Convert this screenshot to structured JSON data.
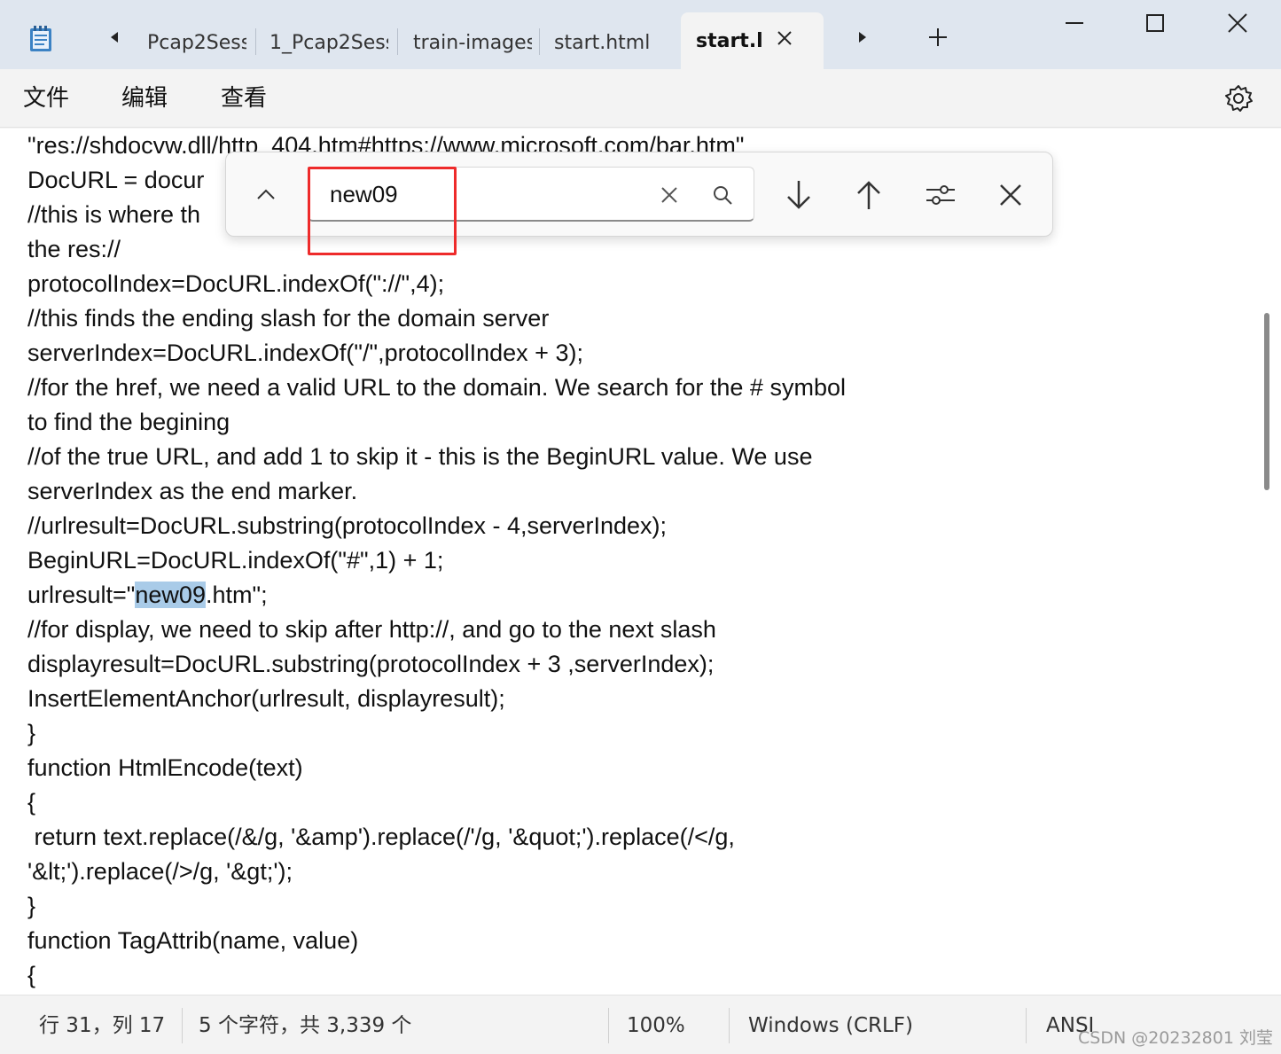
{
  "app": {
    "icon": "notepad-icon"
  },
  "tabs": {
    "items": [
      {
        "label": "Pcap2Sess"
      },
      {
        "label": "1_Pcap2Sess"
      },
      {
        "label": "train-images"
      },
      {
        "label": "start.html"
      }
    ],
    "active": {
      "label": "start.l",
      "close_icon": "close-icon"
    },
    "scroll_left_icon": "triangle-left-icon",
    "scroll_right_icon": "triangle-right-icon",
    "new_tab_icon": "plus-icon"
  },
  "window": {
    "minimize_icon": "minimize-icon",
    "maximize_icon": "maximize-icon",
    "close_icon": "close-icon"
  },
  "menu": {
    "file": "文件",
    "edit": "编辑",
    "view": "查看",
    "settings_icon": "gear-icon"
  },
  "editor": {
    "lines": [
      "\"res://shdocvw.dll/http_404.htm#https://www.microsoft.com/bar.htm\"",
      "DocURL = docur",
      "//this is where th",
      "the res://",
      "protocolIndex=DocURL.indexOf(\"://\",4);",
      "//this finds the ending slash for the domain server",
      "serverIndex=DocURL.indexOf(\"/\",protocolIndex + 3);",
      "//for the href, we need a valid URL to the domain. We search for the # symbol",
      "to find the begining",
      "//of the true URL, and add 1 to skip it - this is the BeginURL value. We use",
      "serverIndex as the end marker.",
      "//urlresult=DocURL.substring(protocolIndex - 4,serverIndex);",
      "BeginURL=DocURL.indexOf(\"#\",1) + 1;",
      null,
      "//for display, we need to skip after http://, and go to the next slash",
      "displayresult=DocURL.substring(protocolIndex + 3 ,serverIndex);",
      "InsertElementAnchor(urlresult, displayresult);",
      "}",
      "function HtmlEncode(text)",
      "{",
      " return text.replace(/&/g, '&amp').replace(/'/g, '&quot;').replace(/</g,",
      "'&lt;').replace(/>/g, '&gt;');",
      "}",
      "function TagAttrib(name, value)",
      "{"
    ],
    "highlight_line": {
      "before": "urlresult=\"",
      "match": "new09",
      "after": ".htm\";"
    }
  },
  "find": {
    "query": "new09",
    "collapse_icon": "chevron-up-icon",
    "clear_icon": "close-icon",
    "search_icon": "search-icon",
    "next_icon": "arrow-down-icon",
    "prev_icon": "arrow-up-icon",
    "options_icon": "sliders-icon",
    "close_icon": "close-icon"
  },
  "status": {
    "position": "行 31，列 17",
    "selection": "5 个字符，共 3,339 个",
    "zoom": "100%",
    "line_ending": "Windows (CRLF)",
    "encoding": "ANSI"
  },
  "watermark": "CSDN @20232801 刘莹"
}
